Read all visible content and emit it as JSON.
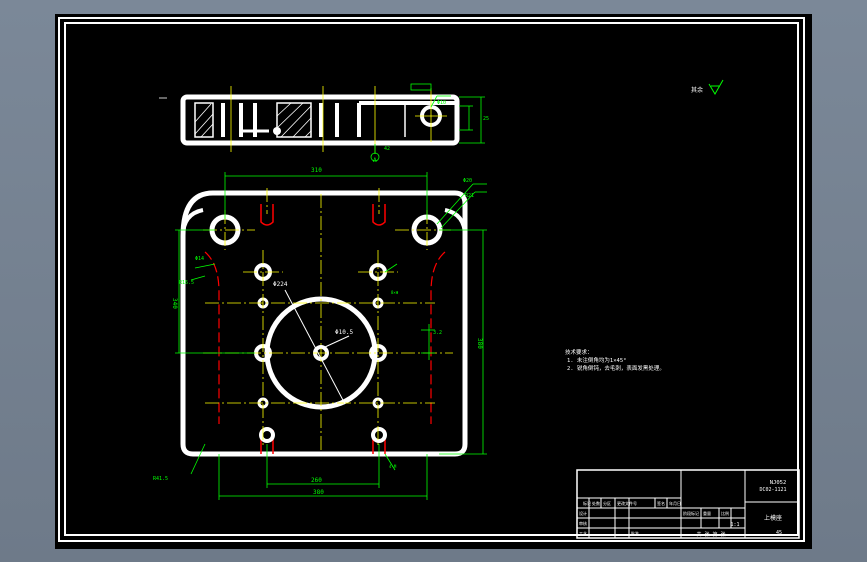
{
  "colors": {
    "background": "#000000",
    "outline": "#ffffff",
    "dimension": "#00ff00",
    "centerline": "#ffff00",
    "hidden": "#ff0000"
  },
  "roughness_label": "其余",
  "dimensions": {
    "width_top": "310",
    "width_bottom_inner": "260",
    "width_bottom": "380",
    "height_left": "340",
    "height_right": "380",
    "dia_large": "Φ224",
    "dia_center": "Φ10.5",
    "dia_slot": "Φ14",
    "side_r": "R16.5",
    "corner_r": "R41.5",
    "top_r1": "Φ20",
    "top_r2": "R21",
    "view_a": "A",
    "view_a_depth": "42",
    "side_dia": "Φ10",
    "side_h": "25",
    "right_small": "3.2",
    "hole_label": "8×Φ",
    "bottom_label": "4-M"
  },
  "tech_notes": {
    "title": "技术要求：",
    "line1": "1. 未注倒角均为1×45°",
    "line2": "2. 锐角倒钝，去毛刺，表面发黑处理。"
  },
  "title_block": {
    "drawing_no_1": "NJ052",
    "drawing_no_2": "DC02-1121",
    "part_name": "上模座",
    "material": "45",
    "scale": "1:1",
    "sheets": "共  张 第  张",
    "header_cells": [
      "标记",
      "处数",
      "分区",
      "更改文件号",
      "签名",
      "年月日"
    ],
    "row_labels": [
      "设计",
      "审核",
      "工艺",
      "批准"
    ],
    "stage_label": "阶段标记",
    "weight_label": "重量",
    "scale_label": "比例"
  }
}
